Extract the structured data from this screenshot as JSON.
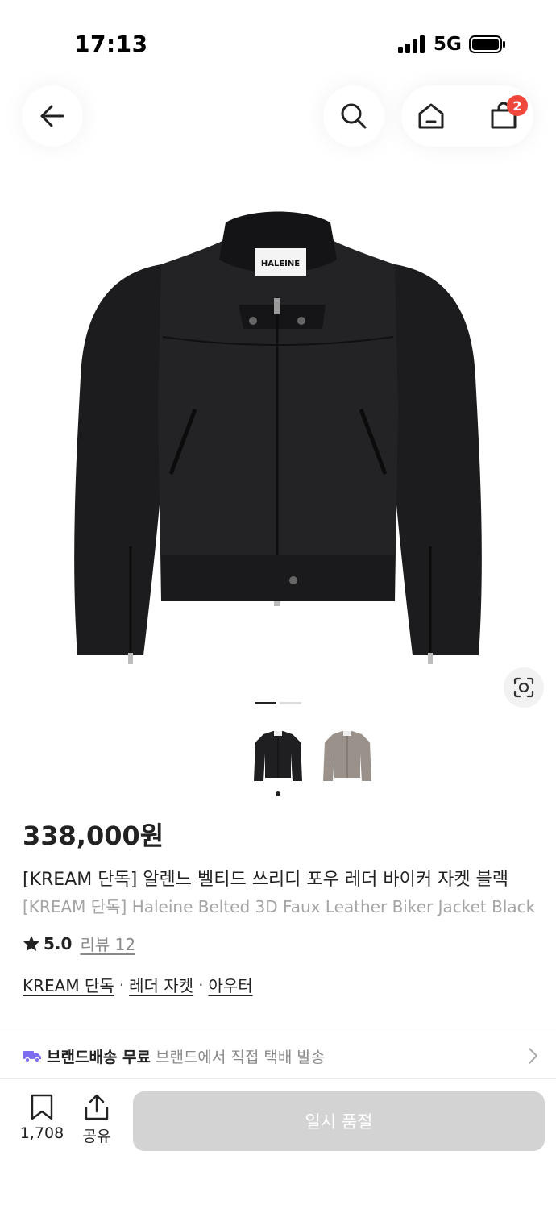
{
  "status_bar": {
    "time": "17:13",
    "network": "5G"
  },
  "header": {
    "cart_badge": "2"
  },
  "gallery": {
    "total_images": 2,
    "current_index": 1
  },
  "colors": {
    "accent_badge": "#f1483e",
    "delivery_icon": "#7b6cf0",
    "soldout_bg": "#d3d3d3"
  },
  "product": {
    "brand_tag": "HALEINE",
    "price": "338,000원",
    "name_ko": "[KREAM 단독] 알렌느 벨티드 쓰리디 포우 레더 바이커 자켓 블랙",
    "name_en": "[KREAM 단독] Haleine Belted 3D Faux Leather Biker Jacket Black",
    "rating": "5.0",
    "review_label": "리뷰 12",
    "tags": [
      "KREAM 단독",
      "레더 자켓",
      "아우터"
    ],
    "tag_separator": "·"
  },
  "delivery": {
    "title": "브랜드배송 무료",
    "description": "브랜드에서 직접 택배 발송"
  },
  "bottom_bar": {
    "bookmark_count": "1,708",
    "share_label": "공유",
    "cta_label": "일시 품절"
  }
}
